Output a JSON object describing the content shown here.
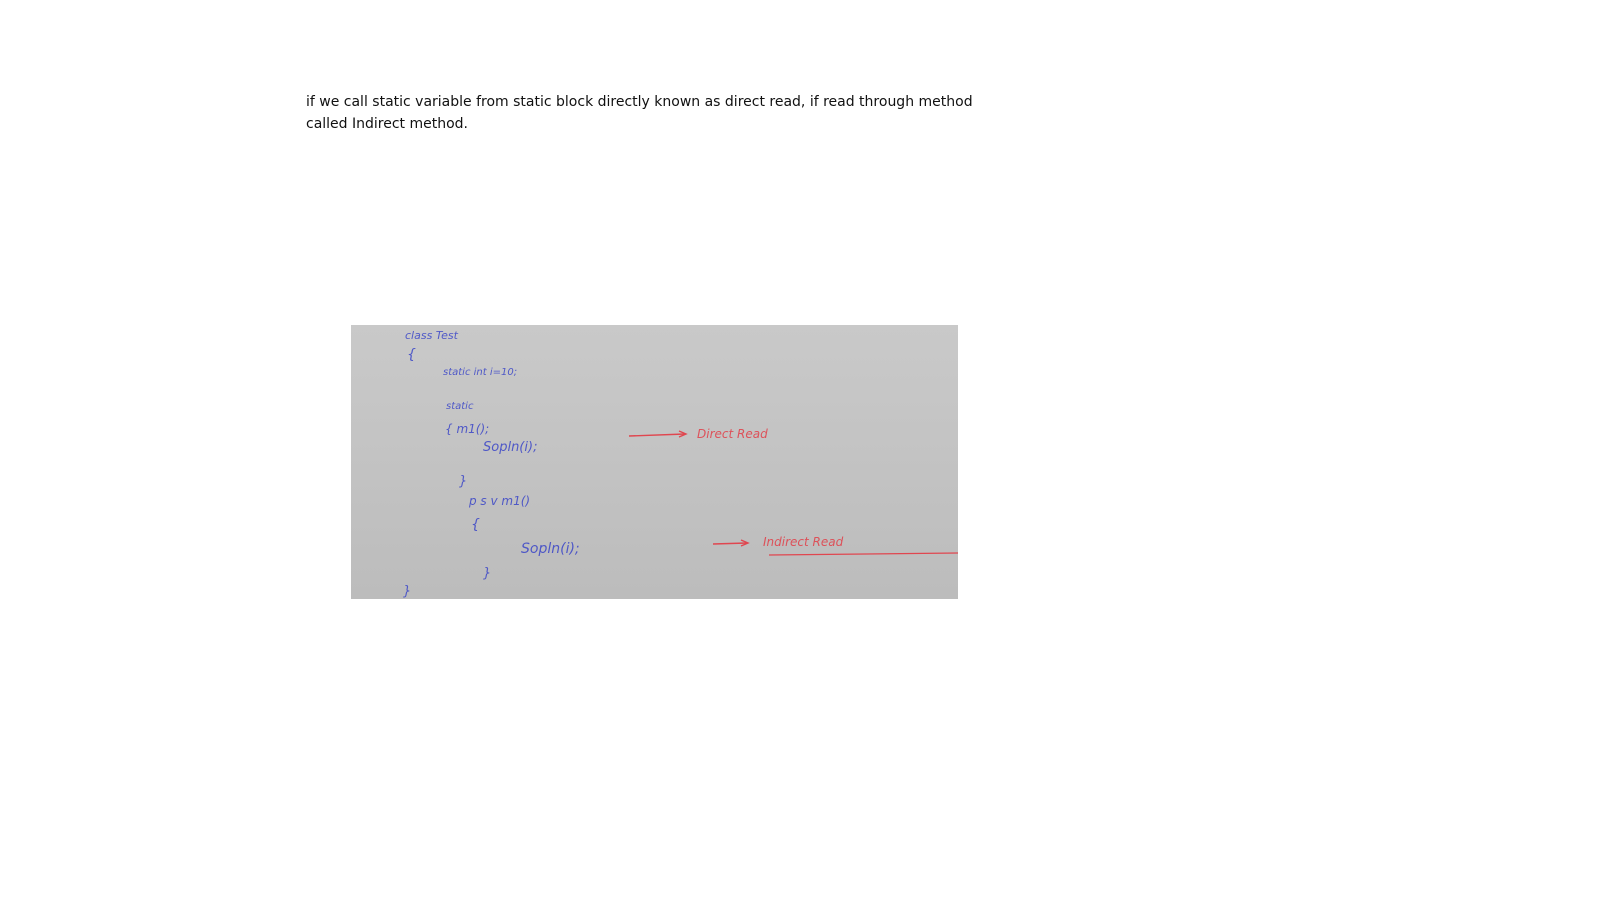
{
  "note": {
    "line1": "if we call static variable from static block directly known as direct read, if read through method",
    "line2": "called Indirect method."
  },
  "whiteboard": {
    "code_lines": [
      "class Test",
      "{",
      "static int i=10;",
      "static",
      "{ m1();",
      "Sopln(i);",
      "}",
      "p s v m1()",
      "{",
      "Sopln(i);",
      "}",
      "}"
    ],
    "annotations": {
      "direct": "Direct Read",
      "indirect": "Indirect Read"
    },
    "colors": {
      "marker_blue": "#3b46c8",
      "marker_red": "#e0464f",
      "board": "#c4c4c4"
    }
  }
}
